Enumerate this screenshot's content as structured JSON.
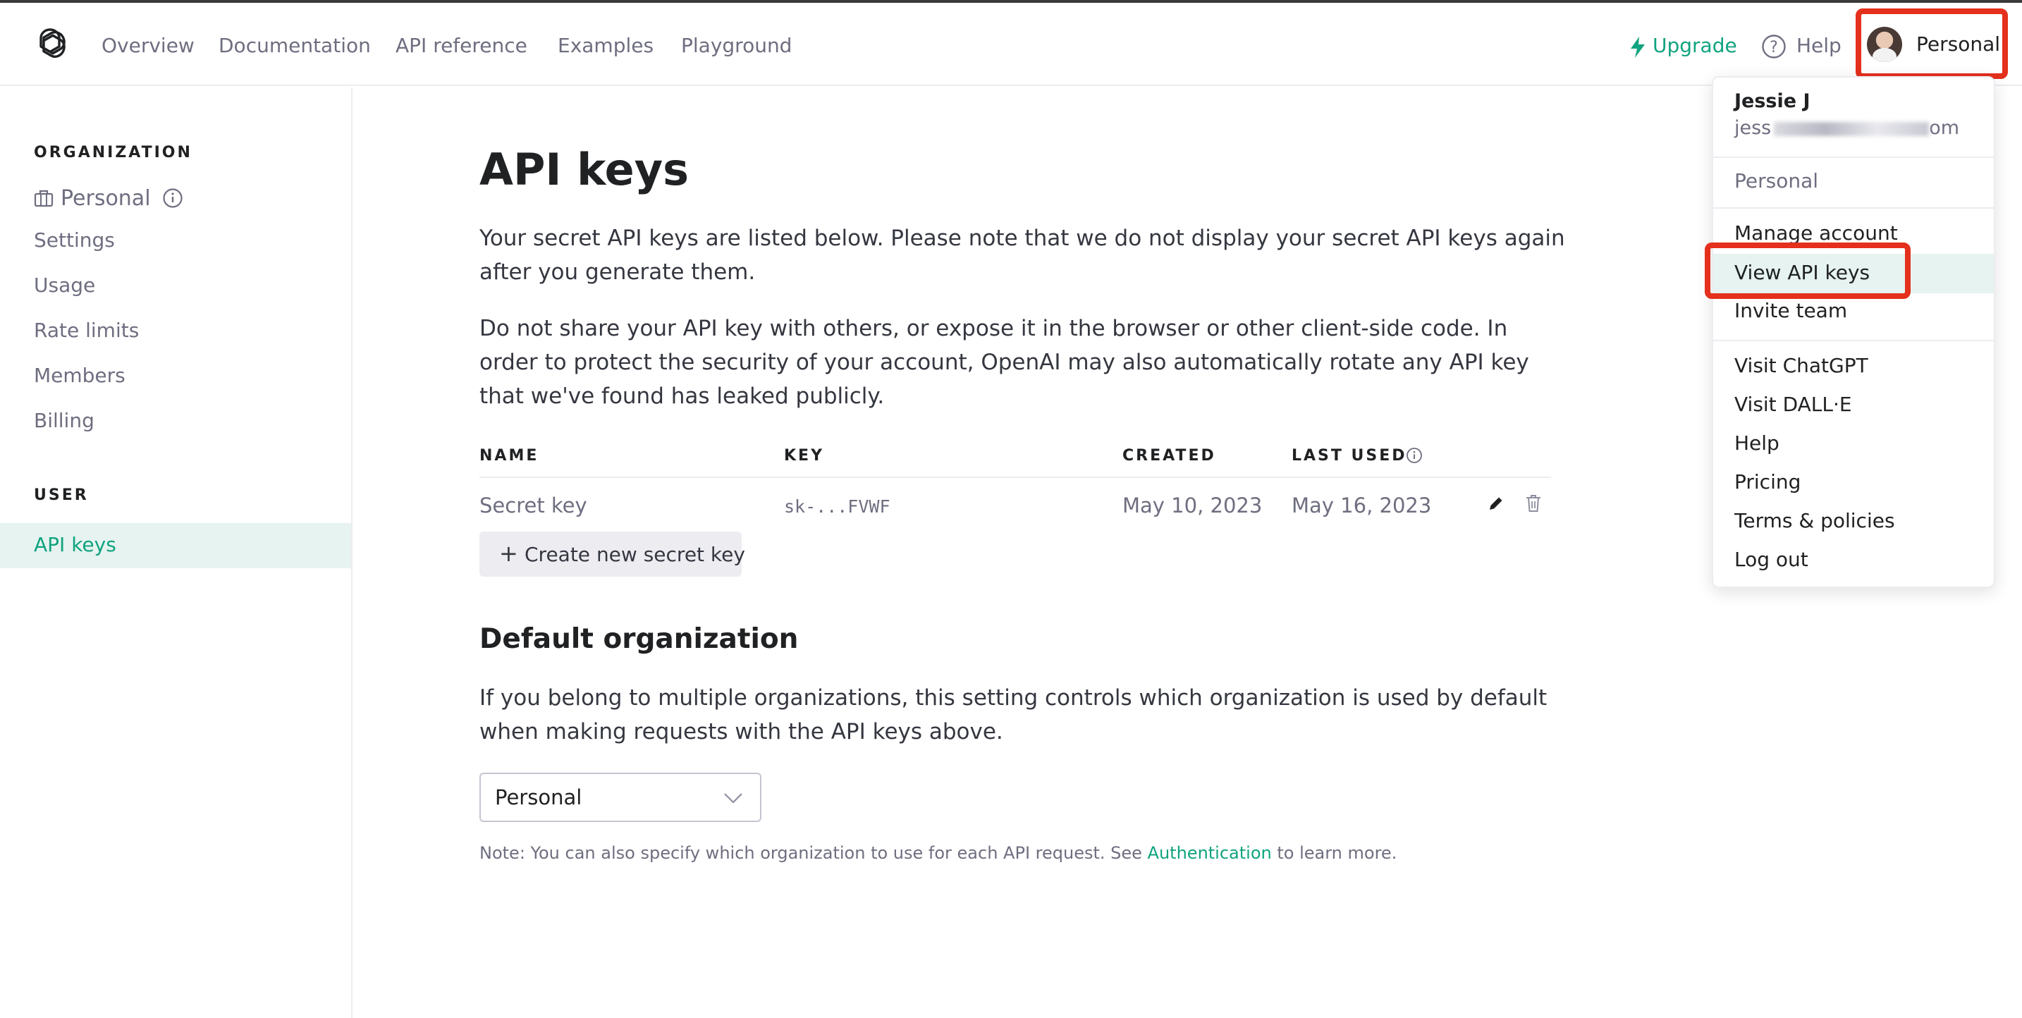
{
  "topnav": {
    "links": [
      "Overview",
      "Documentation",
      "API reference",
      "Examples",
      "Playground"
    ],
    "upgrade_label": "Upgrade",
    "help_label": "Help",
    "profile_label": "Personal"
  },
  "sidebar": {
    "org_heading": "ORGANIZATION",
    "org_name": "Personal",
    "org_items": [
      "Settings",
      "Usage",
      "Rate limits",
      "Members",
      "Billing"
    ],
    "user_heading": "USER",
    "user_items": [
      "API keys"
    ]
  },
  "main": {
    "title": "API keys",
    "intro": "Your secret API keys are listed below. Please note that we do not display your secret API keys again after you generate them.",
    "warning": "Do not share your API key with others, or expose it in the browser or other client-side code. In order to protect the security of your account, OpenAI may also automatically rotate any API key that we've found has leaked publicly.",
    "table": {
      "headers": [
        "NAME",
        "KEY",
        "CREATED",
        "LAST USED"
      ],
      "rows": [
        {
          "name": "Secret key",
          "key": "sk-...FVWF",
          "created": "May 10, 2023",
          "last_used": "May 16, 2023"
        }
      ]
    },
    "create_button": "Create new secret key",
    "default_org_title": "Default organization",
    "default_org_desc": "If you belong to multiple organizations, this setting controls which organization is used by default when making requests with the API keys above.",
    "org_select_value": "Personal",
    "note_prefix": "Note: You can also specify which organization to use for each API request. See",
    "note_link": "Authentication",
    "note_suffix": "to learn more."
  },
  "dropdown": {
    "user_name": "Jessie J",
    "email_visible_start": "jess",
    "email_visible_end": "om",
    "org": "Personal",
    "account_items": [
      "Manage account",
      "View API keys",
      "Invite team"
    ],
    "link_items": [
      "Visit ChatGPT",
      "Visit DALL·E",
      "Help",
      "Pricing",
      "Terms & policies",
      "Log out"
    ]
  },
  "colors": {
    "accent": "#10a37f",
    "highlight_bg": "#e6f3f0",
    "annotation_red": "#e4301c",
    "muted_text": "#6e6e80"
  }
}
